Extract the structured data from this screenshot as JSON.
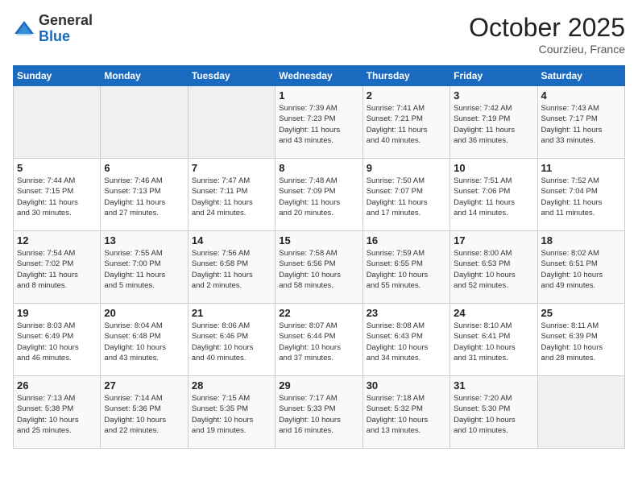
{
  "logo": {
    "general": "General",
    "blue": "Blue"
  },
  "header": {
    "month": "October 2025",
    "location": "Courzieu, France"
  },
  "weekdays": [
    "Sunday",
    "Monday",
    "Tuesday",
    "Wednesday",
    "Thursday",
    "Friday",
    "Saturday"
  ],
  "weeks": [
    [
      {
        "day": "",
        "info": ""
      },
      {
        "day": "",
        "info": ""
      },
      {
        "day": "",
        "info": ""
      },
      {
        "day": "1",
        "info": "Sunrise: 7:39 AM\nSunset: 7:23 PM\nDaylight: 11 hours\nand 43 minutes."
      },
      {
        "day": "2",
        "info": "Sunrise: 7:41 AM\nSunset: 7:21 PM\nDaylight: 11 hours\nand 40 minutes."
      },
      {
        "day": "3",
        "info": "Sunrise: 7:42 AM\nSunset: 7:19 PM\nDaylight: 11 hours\nand 36 minutes."
      },
      {
        "day": "4",
        "info": "Sunrise: 7:43 AM\nSunset: 7:17 PM\nDaylight: 11 hours\nand 33 minutes."
      }
    ],
    [
      {
        "day": "5",
        "info": "Sunrise: 7:44 AM\nSunset: 7:15 PM\nDaylight: 11 hours\nand 30 minutes."
      },
      {
        "day": "6",
        "info": "Sunrise: 7:46 AM\nSunset: 7:13 PM\nDaylight: 11 hours\nand 27 minutes."
      },
      {
        "day": "7",
        "info": "Sunrise: 7:47 AM\nSunset: 7:11 PM\nDaylight: 11 hours\nand 24 minutes."
      },
      {
        "day": "8",
        "info": "Sunrise: 7:48 AM\nSunset: 7:09 PM\nDaylight: 11 hours\nand 20 minutes."
      },
      {
        "day": "9",
        "info": "Sunrise: 7:50 AM\nSunset: 7:07 PM\nDaylight: 11 hours\nand 17 minutes."
      },
      {
        "day": "10",
        "info": "Sunrise: 7:51 AM\nSunset: 7:06 PM\nDaylight: 11 hours\nand 14 minutes."
      },
      {
        "day": "11",
        "info": "Sunrise: 7:52 AM\nSunset: 7:04 PM\nDaylight: 11 hours\nand 11 minutes."
      }
    ],
    [
      {
        "day": "12",
        "info": "Sunrise: 7:54 AM\nSunset: 7:02 PM\nDaylight: 11 hours\nand 8 minutes."
      },
      {
        "day": "13",
        "info": "Sunrise: 7:55 AM\nSunset: 7:00 PM\nDaylight: 11 hours\nand 5 minutes."
      },
      {
        "day": "14",
        "info": "Sunrise: 7:56 AM\nSunset: 6:58 PM\nDaylight: 11 hours\nand 2 minutes."
      },
      {
        "day": "15",
        "info": "Sunrise: 7:58 AM\nSunset: 6:56 PM\nDaylight: 10 hours\nand 58 minutes."
      },
      {
        "day": "16",
        "info": "Sunrise: 7:59 AM\nSunset: 6:55 PM\nDaylight: 10 hours\nand 55 minutes."
      },
      {
        "day": "17",
        "info": "Sunrise: 8:00 AM\nSunset: 6:53 PM\nDaylight: 10 hours\nand 52 minutes."
      },
      {
        "day": "18",
        "info": "Sunrise: 8:02 AM\nSunset: 6:51 PM\nDaylight: 10 hours\nand 49 minutes."
      }
    ],
    [
      {
        "day": "19",
        "info": "Sunrise: 8:03 AM\nSunset: 6:49 PM\nDaylight: 10 hours\nand 46 minutes."
      },
      {
        "day": "20",
        "info": "Sunrise: 8:04 AM\nSunset: 6:48 PM\nDaylight: 10 hours\nand 43 minutes."
      },
      {
        "day": "21",
        "info": "Sunrise: 8:06 AM\nSunset: 6:46 PM\nDaylight: 10 hours\nand 40 minutes."
      },
      {
        "day": "22",
        "info": "Sunrise: 8:07 AM\nSunset: 6:44 PM\nDaylight: 10 hours\nand 37 minutes."
      },
      {
        "day": "23",
        "info": "Sunrise: 8:08 AM\nSunset: 6:43 PM\nDaylight: 10 hours\nand 34 minutes."
      },
      {
        "day": "24",
        "info": "Sunrise: 8:10 AM\nSunset: 6:41 PM\nDaylight: 10 hours\nand 31 minutes."
      },
      {
        "day": "25",
        "info": "Sunrise: 8:11 AM\nSunset: 6:39 PM\nDaylight: 10 hours\nand 28 minutes."
      }
    ],
    [
      {
        "day": "26",
        "info": "Sunrise: 7:13 AM\nSunset: 5:38 PM\nDaylight: 10 hours\nand 25 minutes."
      },
      {
        "day": "27",
        "info": "Sunrise: 7:14 AM\nSunset: 5:36 PM\nDaylight: 10 hours\nand 22 minutes."
      },
      {
        "day": "28",
        "info": "Sunrise: 7:15 AM\nSunset: 5:35 PM\nDaylight: 10 hours\nand 19 minutes."
      },
      {
        "day": "29",
        "info": "Sunrise: 7:17 AM\nSunset: 5:33 PM\nDaylight: 10 hours\nand 16 minutes."
      },
      {
        "day": "30",
        "info": "Sunrise: 7:18 AM\nSunset: 5:32 PM\nDaylight: 10 hours\nand 13 minutes."
      },
      {
        "day": "31",
        "info": "Sunrise: 7:20 AM\nSunset: 5:30 PM\nDaylight: 10 hours\nand 10 minutes."
      },
      {
        "day": "",
        "info": ""
      }
    ]
  ]
}
